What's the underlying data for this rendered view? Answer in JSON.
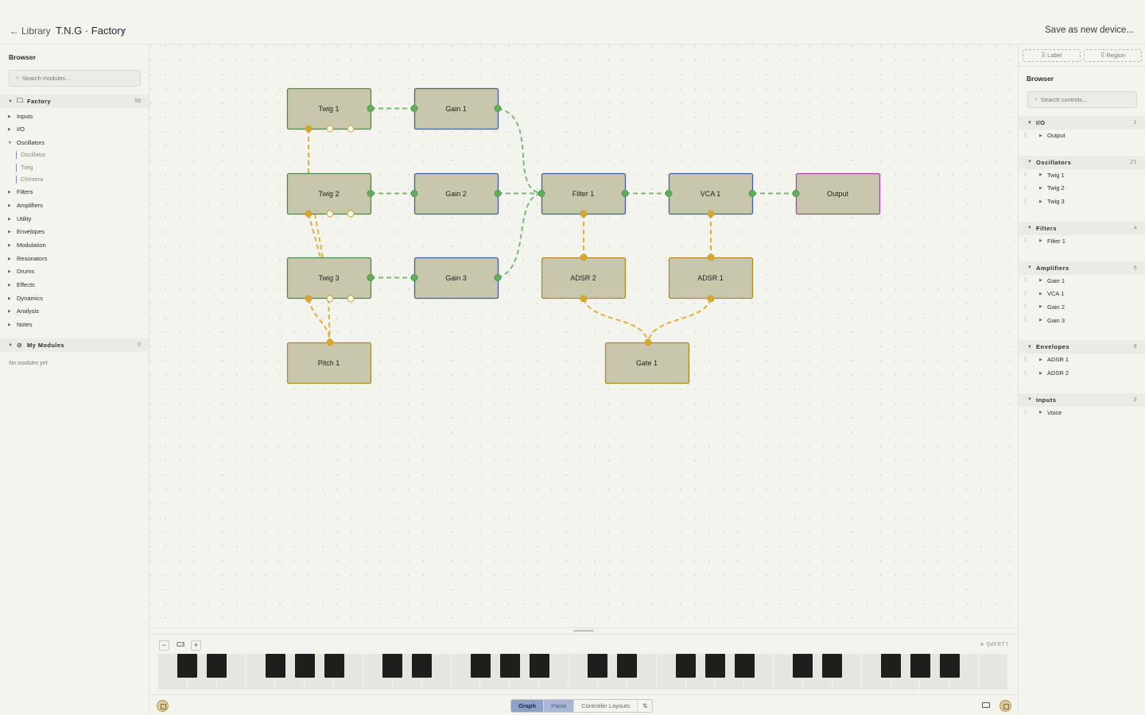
{
  "header": {
    "back_label": "Library",
    "device_title": "T.N.G · Factory",
    "save_label": "Save as new device..."
  },
  "left_browser": {
    "title": "Browser",
    "search_placeholder": "Search modules...",
    "factory": {
      "label": "Factory",
      "count": "58"
    },
    "categories": [
      "Inputs",
      "I/O",
      "Oscillators",
      "Filters",
      "Amplifiers",
      "Utility",
      "Envelopes",
      "Modulation",
      "Resonators",
      "Drums",
      "Effects",
      "Dynamics",
      "Analysis",
      "Notes"
    ],
    "oscillator_children": [
      "Oscillator",
      "Twig",
      "Chimera"
    ],
    "my_modules": {
      "label": "My Modules",
      "count": "0"
    },
    "empty_note": "No modules yet."
  },
  "graph": {
    "nodes": [
      {
        "id": "twig1",
        "label": "Twig 1",
        "kind": "osc"
      },
      {
        "id": "gain1",
        "label": "Gain 1",
        "kind": "amp"
      },
      {
        "id": "twig2",
        "label": "Twig 2",
        "kind": "osc"
      },
      {
        "id": "gain2",
        "label": "Gain 2",
        "kind": "amp"
      },
      {
        "id": "filter1",
        "label": "Filter 1",
        "kind": "amp"
      },
      {
        "id": "vca1",
        "label": "VCA 1",
        "kind": "amp"
      },
      {
        "id": "output",
        "label": "Output",
        "kind": "io"
      },
      {
        "id": "twig3",
        "label": "Twig 3",
        "kind": "osc"
      },
      {
        "id": "gain3",
        "label": "Gain 3",
        "kind": "amp"
      },
      {
        "id": "adsr2",
        "label": "ADSR 2",
        "kind": "env"
      },
      {
        "id": "adsr1",
        "label": "ADSR 1",
        "kind": "env"
      },
      {
        "id": "pitch1",
        "label": "Pitch 1",
        "kind": "env"
      },
      {
        "id": "gate1",
        "label": "Gate 1",
        "kind": "env"
      }
    ],
    "colors": {
      "node_fill": "#c8c7ac",
      "osc_border": "#4e8a46",
      "amp_border": "#3f63a8",
      "io_border": "#a04da0",
      "env_border": "#b08a25",
      "audio_wire": "#7cb87a",
      "mod_wire": "#e0b040"
    }
  },
  "keyboard": {
    "octave_label": "C3",
    "minus_label": "−",
    "plus_label": "+",
    "qwerty_label": "QWERTY"
  },
  "statusbar": {
    "tabs": [
      "Graph",
      "Panel",
      "Controller Layouts"
    ],
    "active_tab": "Graph",
    "extra_symbol": "⇅"
  },
  "right_browser": {
    "label_btn": "Label",
    "region_btn": "Region",
    "title": "Browser",
    "search_placeholder": "Search controls...",
    "groups": [
      {
        "label": "I/O",
        "count": "1",
        "items": [
          "Output"
        ]
      },
      {
        "label": "Oscillators",
        "count": "21",
        "items": [
          "Twig 1",
          "Twig 2",
          "Twig 3"
        ]
      },
      {
        "label": "Filters",
        "count": "4",
        "items": [
          "Filter 1"
        ]
      },
      {
        "label": "Amplifiers",
        "count": "5",
        "items": [
          "Gain 1",
          "VCA 1",
          "Gain 2",
          "Gain 3"
        ]
      },
      {
        "label": "Envelopes",
        "count": "8",
        "items": [
          "ADSR 1",
          "ADSR 2"
        ]
      },
      {
        "label": "Inputs",
        "count": "3",
        "items": [
          "Voice"
        ]
      }
    ]
  }
}
